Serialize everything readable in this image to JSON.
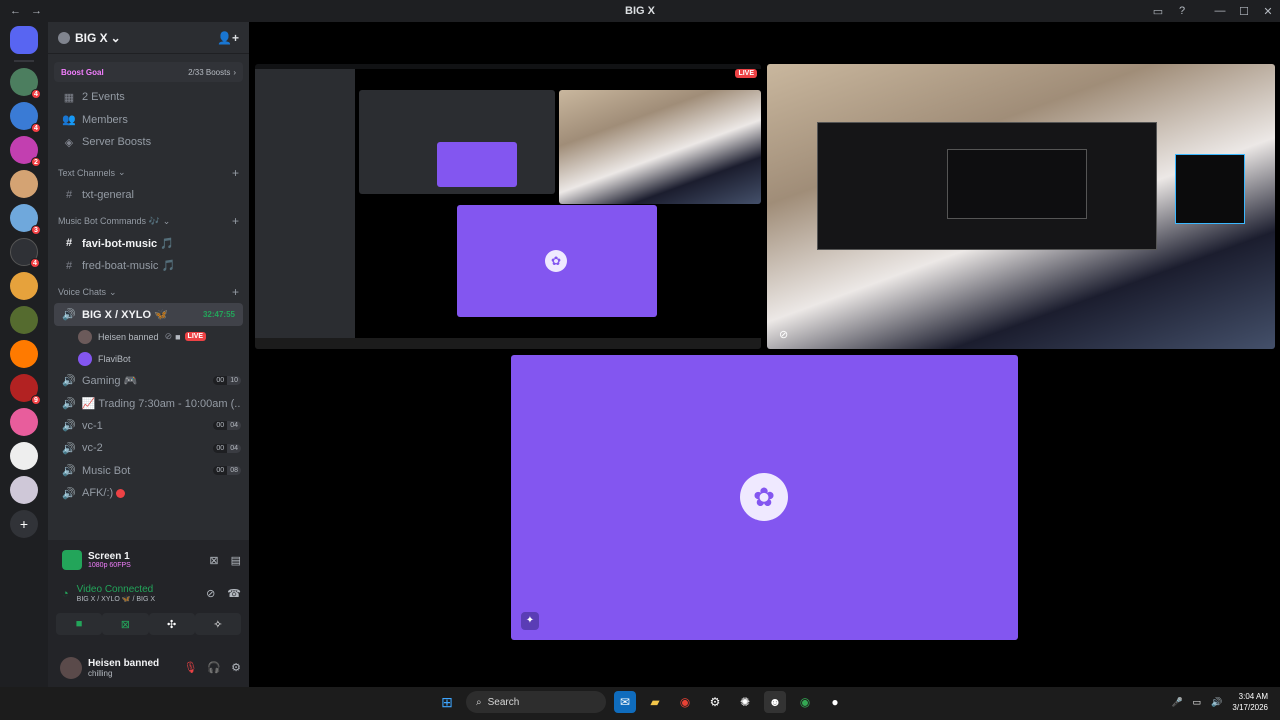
{
  "window": {
    "title": "BIG X",
    "back_icon": "arrow-left-icon",
    "forward_icon": "arrow-right-icon",
    "inbox_icon": "inbox-icon",
    "help_icon": "help-icon",
    "minimize": "—",
    "maximize": "☐",
    "close": "✕"
  },
  "servers": {
    "badges": [
      "4",
      "4",
      "2",
      "3",
      "4",
      "9"
    ]
  },
  "guild": {
    "name": "BIG X",
    "boost_goal_label": "Boost Goal",
    "boost_progress": "2/33 Boosts",
    "items": [
      {
        "icon": "calendar-icon",
        "label": "2 Events"
      },
      {
        "icon": "members-icon",
        "label": "Members"
      },
      {
        "icon": "boost-icon",
        "label": "Server Boosts"
      }
    ]
  },
  "categories": {
    "text": "Text Channels",
    "music": "Music Bot Commands 🎶",
    "voice": "Voice Chats"
  },
  "text_channels": [
    {
      "name": "txt-general"
    }
  ],
  "music_channels": [
    {
      "name": "favi-bot-music 🎵"
    },
    {
      "name": "fred-boat-music 🎵"
    }
  ],
  "voice_channels": {
    "active": {
      "name": "BIG X / XYLO 🦋",
      "time": "32:47:55"
    },
    "members": [
      {
        "name": "Heisen banned",
        "status": "LIVE"
      },
      {
        "name": "FlaviBot"
      }
    ],
    "others": [
      {
        "name": "Gaming 🎮",
        "a": "00",
        "b": "10"
      },
      {
        "name": "📈 Trading 7:30am - 10:00am (...",
        "a": "",
        "b": ""
      },
      {
        "name": "vc-1",
        "a": "00",
        "b": "04"
      },
      {
        "name": "vc-2",
        "a": "00",
        "b": "04"
      },
      {
        "name": "Music Bot",
        "a": "00",
        "b": "08"
      },
      {
        "name": "AFK/:)",
        "a": "",
        "b": ""
      }
    ]
  },
  "panel": {
    "screen_title": "Screen 1",
    "screen_quality": "1080p 60FPS",
    "vc_status": "Video Connected",
    "vc_location": "BIG X / XYLO 🦋 / BIG X"
  },
  "user": {
    "name": "Heisen banned",
    "status": "chilling"
  },
  "stage": {
    "live_label": "LIVE"
  },
  "taskbar": {
    "search_placeholder": "Search",
    "time": "3:04 AM",
    "date": "3/17/2026"
  },
  "colors": {
    "purple": "#8356f0",
    "green": "#23a55a",
    "red": "#ed4245"
  }
}
